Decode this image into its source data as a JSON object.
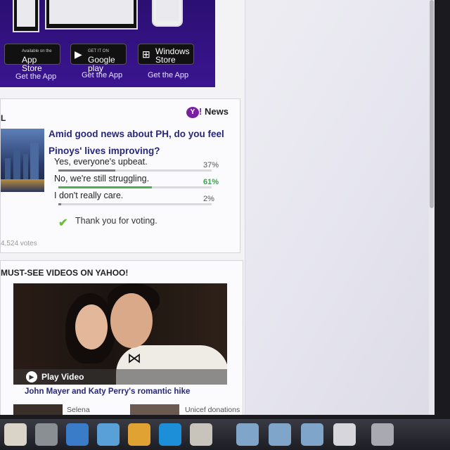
{
  "promo": {
    "badges": [
      {
        "small": "Available on the",
        "label": "App Store",
        "icon": "apple-icon"
      },
      {
        "small": "GET IT ON",
        "label": "Google play",
        "icon": "play-icon"
      },
      {
        "small": "",
        "label": "Windows Store",
        "icon": "windows-icon"
      }
    ],
    "get_app": [
      "Get the App",
      "Get the App",
      "Get the App"
    ]
  },
  "poll": {
    "section_label": "L",
    "brand": "News",
    "question": "Amid good news about PH, do you feel Pinoys' lives improving?",
    "options": [
      {
        "label": "Yes, everyone's upbeat.",
        "pct": "37%",
        "value": 37
      },
      {
        "label": "No, we're still struggling.",
        "pct": "61%",
        "value": 61
      },
      {
        "label": "I don't really care.",
        "pct": "2%",
        "value": 2
      }
    ],
    "thanks": "Thank you for voting.",
    "votes": "4,524 votes"
  },
  "videos": {
    "heading": "MUST-SEE VIDEOS ON YAHOO!",
    "play_label": "Play Video",
    "caption": "John Mayer and Katy Perry's romantic hike",
    "thumbs": [
      "Selena",
      "Unicef donations"
    ]
  },
  "colors": {
    "promo_bg": "#2b0f72",
    "link": "#27277a",
    "winner": "#4caf50"
  }
}
